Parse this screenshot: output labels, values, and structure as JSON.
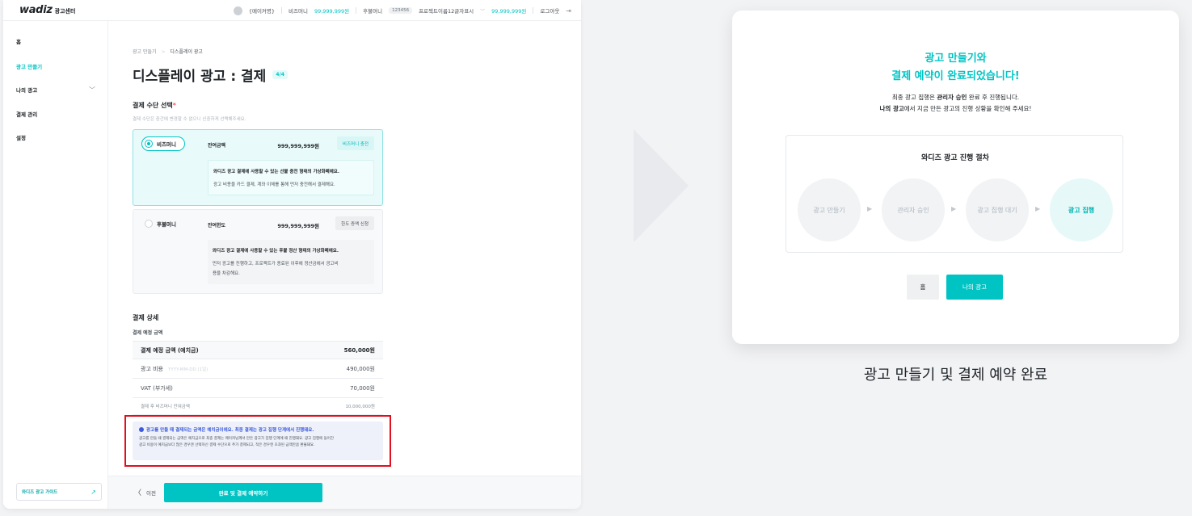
{
  "header": {
    "logo_word": "wadiz",
    "logo_sub": "광고센터",
    "maker_name": "{메이커명}",
    "biz_money_label": "비즈머니",
    "biz_money_value": "99,999,999원",
    "post_money_label": "후불머니",
    "project_id": "123456",
    "project_name": "프로젝트이름12글자표시",
    "project_value": "99,999,999원",
    "logout": "로그아웃"
  },
  "sidebar": {
    "items": [
      {
        "label": "홈"
      },
      {
        "label": "광고 만들기"
      },
      {
        "label": "나의 광고"
      },
      {
        "label": "결제 관리"
      },
      {
        "label": "설정"
      }
    ],
    "guide_label": "와디즈 광고 가이드"
  },
  "page": {
    "breadcrumb": [
      "광고 만들기",
      "디스플레이 광고"
    ],
    "title": "디스플레이 광고 : 결제",
    "step": "4/4"
  },
  "payment_method": {
    "title": "결제 수단 선택",
    "required_mark": "*",
    "help": "결제 수단은 중간에 변경할 수 없으니 신중하게 선택해주세요.",
    "options": [
      {
        "name": "비즈머니",
        "balance_label": "잔여금액",
        "balance": "999,999,999원",
        "button": "비즈머니 충전",
        "line1": "와디즈 광고 결제에 사용할 수 있는 선불 충전 형태의 가상화폐예요.",
        "line2": "광고 비용을 카드 결제, 계좌 이체를 통해 먼저 충전해서 결제해요."
      },
      {
        "name": "후불머니",
        "balance_label": "잔여한도",
        "balance": "999,999,999원",
        "button": "한도 증액 신청",
        "line1": "와디즈 광고 결제에 사용할 수 있는 후불 정산 형태의 가상화폐예요.",
        "line2": "먼저 광고를 진행하고, 프로젝트가 종료된 이후에 정산금에서 광고비",
        "line3": "용을 차감해요."
      }
    ]
  },
  "payment_detail": {
    "title": "결제 상세",
    "subtitle": "결제 예정 금액",
    "rows": [
      {
        "label": "결제 예정 금액 (예치금)",
        "value": "560,000원"
      },
      {
        "label": "광고 비용",
        "placeholder": "YYYY-MM-DD (1일)",
        "value": "490,000원"
      },
      {
        "label": "VAT (부가세)",
        "value": "70,000원"
      },
      {
        "label": "결제 후 비즈머니 잔여금액",
        "value": "10,000,000원"
      }
    ]
  },
  "notice": {
    "headline": "광고를 만들 때 결제되는 금액은 예치금이에요. 최종 결제는 광고 집행 단계에서 진행돼요.",
    "body1": "광고를 만들 때 결제되는 금액은 예치금으로 최종 결제는 메이커님께서 만든 광고가 집행 단계에 때 진행돼요. 광고 집행에 들어간",
    "body2": "광고 비용이 예치금보다 많은 경우엔 선택하신 결제 수단으로 추가 결제되고, 적은 경우엔 초과된 금액만큼 환불돼요."
  },
  "footer": {
    "prev": "이전",
    "submit": "완료 및 결제 예약하기"
  },
  "modal": {
    "title_line1": "광고 만들기와",
    "title_line2": "결제 예약이 완료되었습니다!",
    "desc1_pre": "최종 광고 집행은 ",
    "desc1_bold": "관리자 승인",
    "desc1_post": " 완료 후 진행됩니다.",
    "desc2_bold": "나의 광고",
    "desc2_post": "에서 지금 만든 광고의 진행 상황을 확인해 주세요!",
    "process_title": "와디즈 광고 진행 절차",
    "steps": [
      "광고 만들기",
      "관리자 승인",
      "광고 집행 대기",
      "광고 집행"
    ],
    "home_button": "홈",
    "my_ads_button": "나의 광고"
  },
  "caption": "광고 만들기 및 결제 예약 완료",
  "colors": {
    "accent": "#00c4c4",
    "highlight_border": "#e10f1e",
    "notice_blue": "#3b5bdb"
  }
}
